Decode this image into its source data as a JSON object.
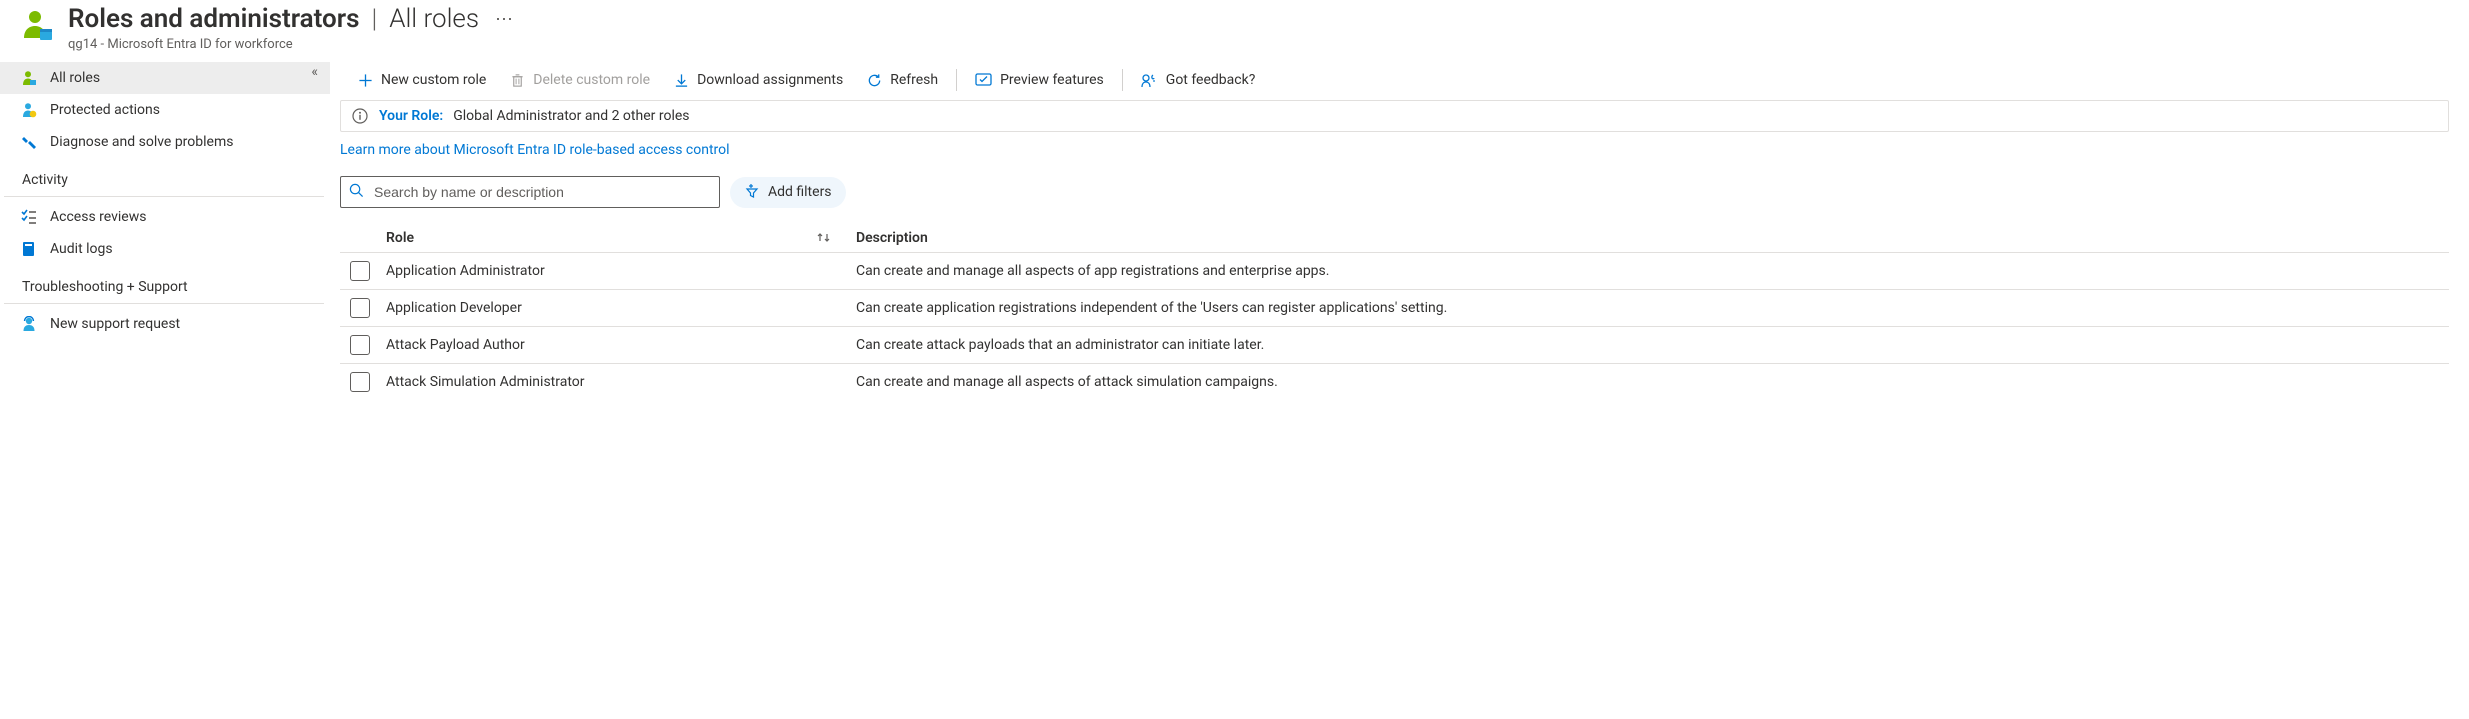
{
  "header": {
    "title_main": "Roles and administrators",
    "title_context": "All roles",
    "subtitle": "qg14 - Microsoft Entra ID for workforce"
  },
  "sidebar": {
    "items": [
      {
        "label": "All roles",
        "icon": "person-icon",
        "selected": true
      },
      {
        "label": "Protected actions",
        "icon": "shield-person-icon",
        "selected": false
      },
      {
        "label": "Diagnose and solve problems",
        "icon": "wrench-icon",
        "selected": false
      }
    ],
    "sections": [
      {
        "label": "Activity",
        "items": [
          {
            "label": "Access reviews",
            "icon": "checklist-icon"
          },
          {
            "label": "Audit logs",
            "icon": "book-icon"
          }
        ]
      },
      {
        "label": "Troubleshooting + Support",
        "items": [
          {
            "label": "New support request",
            "icon": "support-person-icon"
          }
        ]
      }
    ]
  },
  "toolbar": {
    "new_custom_role": "New custom role",
    "delete_custom_role": "Delete custom role",
    "download_assignments": "Download assignments",
    "refresh": "Refresh",
    "preview_features": "Preview features",
    "got_feedback": "Got feedback?"
  },
  "role_banner": {
    "label": "Your Role:",
    "value": "Global Administrator and 2 other roles"
  },
  "learn_more": "Learn more about Microsoft Entra ID role-based access control",
  "search": {
    "placeholder": "Search by name or description",
    "add_filters": "Add filters"
  },
  "table": {
    "columns": {
      "role": "Role",
      "description": "Description"
    },
    "rows": [
      {
        "name": "Application Administrator",
        "desc": "Can create and manage all aspects of app registrations and enterprise apps."
      },
      {
        "name": "Application Developer",
        "desc": "Can create application registrations independent of the 'Users can register applications' setting."
      },
      {
        "name": "Attack Payload Author",
        "desc": "Can create attack payloads that an administrator can initiate later."
      },
      {
        "name": "Attack Simulation Administrator",
        "desc": "Can create and manage all aspects of attack simulation campaigns."
      }
    ]
  }
}
